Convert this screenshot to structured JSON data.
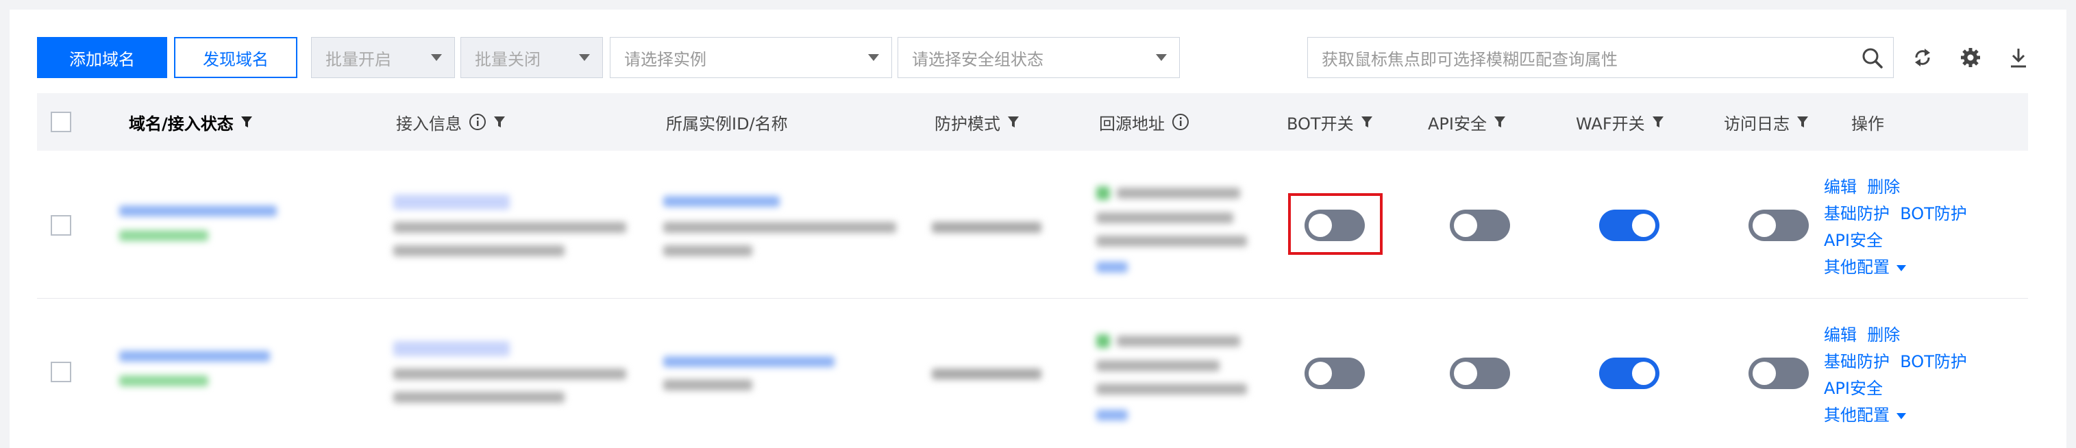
{
  "toolbar": {
    "add_domain": "添加域名",
    "discover_domain": "发现域名",
    "batch_enable": "批量开启",
    "batch_disable": "批量关闭",
    "select_instance_placeholder": "请选择实例",
    "select_security_group_placeholder": "请选择安全组状态",
    "search_placeholder": "获取鼠标焦点即可选择模糊匹配查询属性"
  },
  "table": {
    "columns": {
      "domain": "域名/接入状态",
      "access_info": "接入信息",
      "instance": "所属实例ID/名称",
      "protection_mode": "防护模式",
      "origin": "回源地址",
      "bot": "BOT开关",
      "api": "API安全",
      "waf": "WAF开关",
      "access_log": "访问日志",
      "actions": "操作"
    },
    "rows": [
      {
        "bot_on": false,
        "api_on": false,
        "waf_on": true,
        "log_on": false,
        "bot_highlighted": true
      },
      {
        "bot_on": false,
        "api_on": false,
        "waf_on": true,
        "log_on": false,
        "bot_highlighted": false
      }
    ],
    "actions": {
      "edit": "编辑",
      "delete": "删除",
      "basic_protection": "基础防护",
      "bot_protection": "BOT防护",
      "api_security": "API安全",
      "other_config": "其他配置"
    }
  },
  "colors": {
    "primary": "#006eff",
    "toggle_on": "#1a67e8",
    "toggle_off": "#737b8c",
    "highlight": "#e0161c"
  }
}
